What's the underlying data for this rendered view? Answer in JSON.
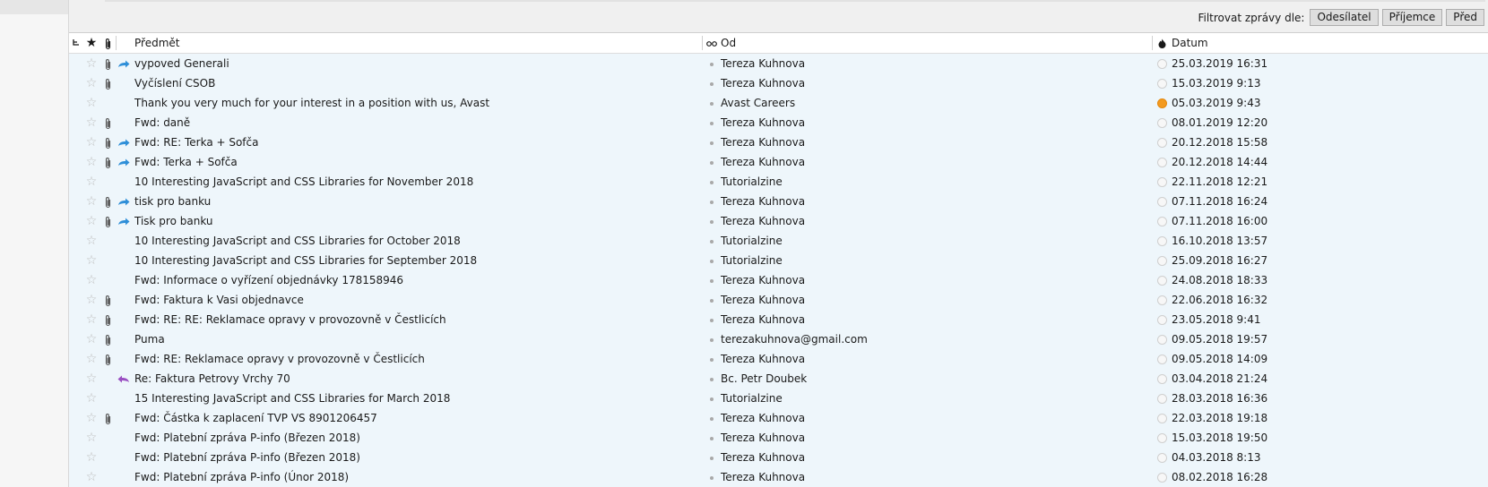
{
  "filter": {
    "label": "Filtrovat zprávy dle:",
    "buttons": [
      "Odesílatel",
      "Příjemce",
      "Před"
    ]
  },
  "header": {
    "subject": "Předmět",
    "from": "Od",
    "date": "Datum"
  },
  "icons": {
    "thread": "thread-icon",
    "star": "star-icon",
    "attachment": "paperclip-icon",
    "forwarded": "forward-arrow-icon",
    "replied": "reply-arrow-icon",
    "junk": "junk-status-icon",
    "correspondents": "correspondents-icon"
  },
  "colors": {
    "row_background": "#eef6fb",
    "forward_arrow": "#2f8fd8",
    "reply_arrow": "#9a4fc2",
    "junk_flag": "#f39a1f"
  },
  "messages": [
    {
      "subject": "vypoved Generali",
      "from": "Tereza Kuhnova",
      "date": "25.03.2019 16:31",
      "attachment": true,
      "status": "forwarded",
      "junk": false
    },
    {
      "subject": "Vyčíslení CSOB",
      "from": "Tereza Kuhnova",
      "date": "15.03.2019 9:13",
      "attachment": true,
      "status": "",
      "junk": false
    },
    {
      "subject": "Thank you very much for your interest in a position with us, Avast",
      "from": "Avast Careers",
      "date": "05.03.2019 9:43",
      "attachment": false,
      "status": "",
      "junk": true
    },
    {
      "subject": "Fwd: daně",
      "from": "Tereza Kuhnova",
      "date": "08.01.2019 12:20",
      "attachment": true,
      "status": "",
      "junk": false
    },
    {
      "subject": "Fwd: RE: Terka + Sofča",
      "from": "Tereza Kuhnova",
      "date": "20.12.2018 15:58",
      "attachment": true,
      "status": "forwarded",
      "junk": false
    },
    {
      "subject": "Fwd: Terka + Sofča",
      "from": "Tereza Kuhnova",
      "date": "20.12.2018 14:44",
      "attachment": true,
      "status": "forwarded",
      "junk": false
    },
    {
      "subject": "10 Interesting JavaScript and CSS Libraries for November 2018",
      "from": "Tutorialzine",
      "date": "22.11.2018 12:21",
      "attachment": false,
      "status": "",
      "junk": false
    },
    {
      "subject": "tisk pro banku",
      "from": "Tereza Kuhnova",
      "date": "07.11.2018 16:24",
      "attachment": true,
      "status": "forwarded",
      "junk": false
    },
    {
      "subject": "Tisk pro banku",
      "from": "Tereza Kuhnova",
      "date": "07.11.2018 16:00",
      "attachment": true,
      "status": "forwarded",
      "junk": false
    },
    {
      "subject": "10 Interesting JavaScript and CSS Libraries for October 2018",
      "from": "Tutorialzine",
      "date": "16.10.2018 13:57",
      "attachment": false,
      "status": "",
      "junk": false
    },
    {
      "subject": "10 Interesting JavaScript and CSS Libraries for September 2018",
      "from": "Tutorialzine",
      "date": "25.09.2018 16:27",
      "attachment": false,
      "status": "",
      "junk": false
    },
    {
      "subject": "Fwd: Informace o vyřízení objednávky 178158946",
      "from": "Tereza Kuhnova",
      "date": "24.08.2018 18:33",
      "attachment": false,
      "status": "",
      "junk": false
    },
    {
      "subject": "Fwd: Faktura k Vasi objednavce",
      "from": "Tereza Kuhnova",
      "date": "22.06.2018 16:32",
      "attachment": true,
      "status": "",
      "junk": false
    },
    {
      "subject": "Fwd: RE: RE: Reklamace opravy v provozovně v Čestlicích",
      "from": "Tereza Kuhnova",
      "date": "23.05.2018 9:41",
      "attachment": true,
      "status": "",
      "junk": false
    },
    {
      "subject": "Puma",
      "from": "terezakuhnova@gmail.com",
      "date": "09.05.2018 19:57",
      "attachment": true,
      "status": "",
      "junk": false
    },
    {
      "subject": "Fwd: RE: Reklamace opravy v provozovně v Čestlicích",
      "from": "Tereza Kuhnova",
      "date": "09.05.2018 14:09",
      "attachment": true,
      "status": "",
      "junk": false
    },
    {
      "subject": "Re: Faktura Petrovy Vrchy 70",
      "from": "Bc. Petr Doubek",
      "date": "03.04.2018 21:24",
      "attachment": false,
      "status": "replied",
      "junk": false
    },
    {
      "subject": "15 Interesting JavaScript and CSS Libraries for March 2018",
      "from": "Tutorialzine",
      "date": "28.03.2018 16:36",
      "attachment": false,
      "status": "",
      "junk": false
    },
    {
      "subject": "Fwd: Částka k zaplacení  TVP VS 8901206457",
      "from": "Tereza Kuhnova",
      "date": "22.03.2018 19:18",
      "attachment": true,
      "status": "",
      "junk": false
    },
    {
      "subject": "Fwd: Platební zpráva P-info (Březen 2018)",
      "from": "Tereza Kuhnova",
      "date": "15.03.2018 19:50",
      "attachment": false,
      "status": "",
      "junk": false
    },
    {
      "subject": "Fwd: Platební zpráva P-info (Březen 2018)",
      "from": "Tereza Kuhnova",
      "date": "04.03.2018 8:13",
      "attachment": false,
      "status": "",
      "junk": false
    },
    {
      "subject": "Fwd: Platební zpráva P-info (Únor 2018)",
      "from": "Tereza Kuhnova",
      "date": "08.02.2018 16:28",
      "attachment": false,
      "status": "",
      "junk": false
    }
  ]
}
